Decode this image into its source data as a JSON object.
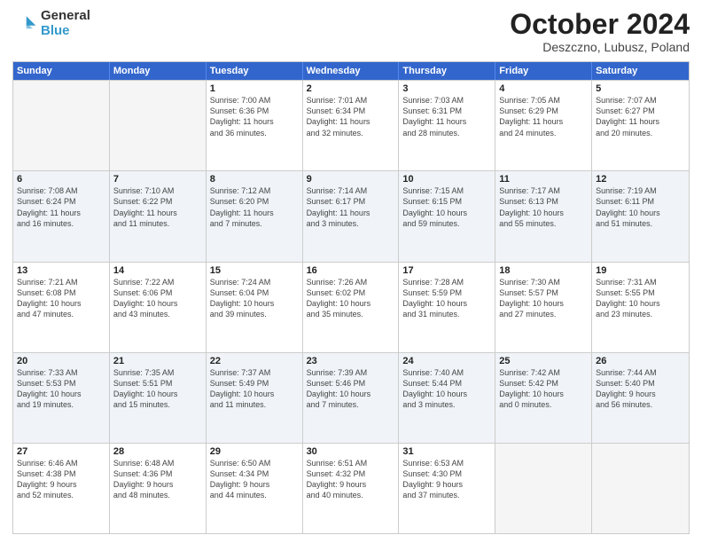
{
  "logo": {
    "general": "General",
    "blue": "Blue"
  },
  "title": "October 2024",
  "subtitle": "Deszczno, Lubusz, Poland",
  "header_days": [
    "Sunday",
    "Monday",
    "Tuesday",
    "Wednesday",
    "Thursday",
    "Friday",
    "Saturday"
  ],
  "rows": [
    [
      {
        "day": "",
        "info": ""
      },
      {
        "day": "",
        "info": ""
      },
      {
        "day": "1",
        "info": "Sunrise: 7:00 AM\nSunset: 6:36 PM\nDaylight: 11 hours\nand 36 minutes."
      },
      {
        "day": "2",
        "info": "Sunrise: 7:01 AM\nSunset: 6:34 PM\nDaylight: 11 hours\nand 32 minutes."
      },
      {
        "day": "3",
        "info": "Sunrise: 7:03 AM\nSunset: 6:31 PM\nDaylight: 11 hours\nand 28 minutes."
      },
      {
        "day": "4",
        "info": "Sunrise: 7:05 AM\nSunset: 6:29 PM\nDaylight: 11 hours\nand 24 minutes."
      },
      {
        "day": "5",
        "info": "Sunrise: 7:07 AM\nSunset: 6:27 PM\nDaylight: 11 hours\nand 20 minutes."
      }
    ],
    [
      {
        "day": "6",
        "info": "Sunrise: 7:08 AM\nSunset: 6:24 PM\nDaylight: 11 hours\nand 16 minutes."
      },
      {
        "day": "7",
        "info": "Sunrise: 7:10 AM\nSunset: 6:22 PM\nDaylight: 11 hours\nand 11 minutes."
      },
      {
        "day": "8",
        "info": "Sunrise: 7:12 AM\nSunset: 6:20 PM\nDaylight: 11 hours\nand 7 minutes."
      },
      {
        "day": "9",
        "info": "Sunrise: 7:14 AM\nSunset: 6:17 PM\nDaylight: 11 hours\nand 3 minutes."
      },
      {
        "day": "10",
        "info": "Sunrise: 7:15 AM\nSunset: 6:15 PM\nDaylight: 10 hours\nand 59 minutes."
      },
      {
        "day": "11",
        "info": "Sunrise: 7:17 AM\nSunset: 6:13 PM\nDaylight: 10 hours\nand 55 minutes."
      },
      {
        "day": "12",
        "info": "Sunrise: 7:19 AM\nSunset: 6:11 PM\nDaylight: 10 hours\nand 51 minutes."
      }
    ],
    [
      {
        "day": "13",
        "info": "Sunrise: 7:21 AM\nSunset: 6:08 PM\nDaylight: 10 hours\nand 47 minutes."
      },
      {
        "day": "14",
        "info": "Sunrise: 7:22 AM\nSunset: 6:06 PM\nDaylight: 10 hours\nand 43 minutes."
      },
      {
        "day": "15",
        "info": "Sunrise: 7:24 AM\nSunset: 6:04 PM\nDaylight: 10 hours\nand 39 minutes."
      },
      {
        "day": "16",
        "info": "Sunrise: 7:26 AM\nSunset: 6:02 PM\nDaylight: 10 hours\nand 35 minutes."
      },
      {
        "day": "17",
        "info": "Sunrise: 7:28 AM\nSunset: 5:59 PM\nDaylight: 10 hours\nand 31 minutes."
      },
      {
        "day": "18",
        "info": "Sunrise: 7:30 AM\nSunset: 5:57 PM\nDaylight: 10 hours\nand 27 minutes."
      },
      {
        "day": "19",
        "info": "Sunrise: 7:31 AM\nSunset: 5:55 PM\nDaylight: 10 hours\nand 23 minutes."
      }
    ],
    [
      {
        "day": "20",
        "info": "Sunrise: 7:33 AM\nSunset: 5:53 PM\nDaylight: 10 hours\nand 19 minutes."
      },
      {
        "day": "21",
        "info": "Sunrise: 7:35 AM\nSunset: 5:51 PM\nDaylight: 10 hours\nand 15 minutes."
      },
      {
        "day": "22",
        "info": "Sunrise: 7:37 AM\nSunset: 5:49 PM\nDaylight: 10 hours\nand 11 minutes."
      },
      {
        "day": "23",
        "info": "Sunrise: 7:39 AM\nSunset: 5:46 PM\nDaylight: 10 hours\nand 7 minutes."
      },
      {
        "day": "24",
        "info": "Sunrise: 7:40 AM\nSunset: 5:44 PM\nDaylight: 10 hours\nand 3 minutes."
      },
      {
        "day": "25",
        "info": "Sunrise: 7:42 AM\nSunset: 5:42 PM\nDaylight: 10 hours\nand 0 minutes."
      },
      {
        "day": "26",
        "info": "Sunrise: 7:44 AM\nSunset: 5:40 PM\nDaylight: 9 hours\nand 56 minutes."
      }
    ],
    [
      {
        "day": "27",
        "info": "Sunrise: 6:46 AM\nSunset: 4:38 PM\nDaylight: 9 hours\nand 52 minutes."
      },
      {
        "day": "28",
        "info": "Sunrise: 6:48 AM\nSunset: 4:36 PM\nDaylight: 9 hours\nand 48 minutes."
      },
      {
        "day": "29",
        "info": "Sunrise: 6:50 AM\nSunset: 4:34 PM\nDaylight: 9 hours\nand 44 minutes."
      },
      {
        "day": "30",
        "info": "Sunrise: 6:51 AM\nSunset: 4:32 PM\nDaylight: 9 hours\nand 40 minutes."
      },
      {
        "day": "31",
        "info": "Sunrise: 6:53 AM\nSunset: 4:30 PM\nDaylight: 9 hours\nand 37 minutes."
      },
      {
        "day": "",
        "info": ""
      },
      {
        "day": "",
        "info": ""
      }
    ]
  ]
}
